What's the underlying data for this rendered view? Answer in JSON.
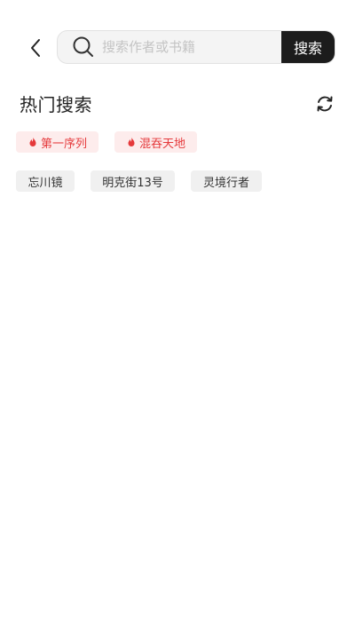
{
  "search": {
    "placeholder": "搜索作者或书籍",
    "value": "",
    "button_label": "搜索"
  },
  "hot_search": {
    "title": "热门搜索",
    "hot_tags": [
      {
        "label": "第一序列",
        "icon": "flame-icon"
      },
      {
        "label": "混吞天地",
        "icon": "flame-icon"
      }
    ],
    "tags": [
      {
        "label": "忘川镜"
      },
      {
        "label": "明克街13号"
      },
      {
        "label": "灵境行者"
      }
    ]
  },
  "icons": {
    "back": "chevron-left-icon",
    "search": "search-icon",
    "refresh": "refresh-icon"
  },
  "colors": {
    "accent": "#e5393b",
    "hot_tag_bg": "#fdecec",
    "tag_bg": "#f0f0f0",
    "search_button_bg": "#1c1c1c"
  }
}
